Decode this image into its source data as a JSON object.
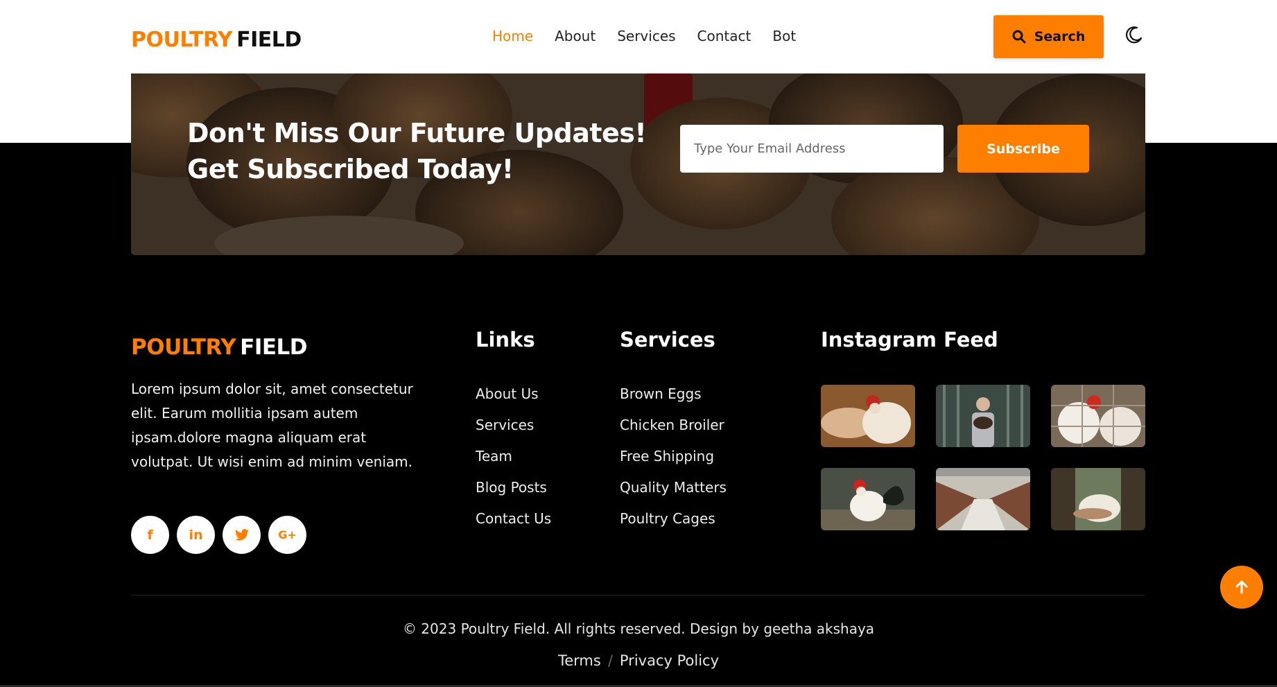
{
  "header": {
    "logo_primary": "POULTRY",
    "logo_secondary": "FIELD",
    "nav": [
      {
        "label": "Home",
        "active": true
      },
      {
        "label": "About"
      },
      {
        "label": "Services"
      },
      {
        "label": "Contact"
      },
      {
        "label": "Bot"
      }
    ],
    "search_label": "Search",
    "search_icon": "search-icon",
    "theme_icon": "moon-icon"
  },
  "banner": {
    "headline": "Don't Miss Our Future Updates!\nGet Subscribed Today!",
    "email_placeholder": "Type Your Email Address",
    "subscribe_label": "Subscribe"
  },
  "footer": {
    "logo_primary": "POULTRY",
    "logo_secondary": "FIELD",
    "about_text": "Lorem ipsum dolor sit, amet consectetur elit. Earum mollitia ipsam autem ipsam.dolore magna aliquam erat volutpat. Ut wisi enim ad minim veniam.",
    "socials": [
      {
        "icon": "facebook-icon",
        "glyph": "f"
      },
      {
        "icon": "linkedin-icon",
        "glyph": "in"
      },
      {
        "icon": "twitter-icon",
        "glyph": "t"
      },
      {
        "icon": "google-plus-icon",
        "glyph": "G+"
      }
    ],
    "links": {
      "title": "Links",
      "items": [
        "About Us",
        "Services",
        "Team",
        "Blog Posts",
        "Contact Us"
      ]
    },
    "services": {
      "title": "Services",
      "items": [
        "Brown Eggs",
        "Chicken Broiler",
        "Free Shipping",
        "Quality Matters",
        "Poultry Cages"
      ]
    },
    "instagram": {
      "title": "Instagram Feed",
      "images": [
        "hand-feeding-hen",
        "farmer-holding-chicken",
        "hens-in-cage",
        "rooster",
        "poultry-house-rows",
        "man-holding-hen"
      ]
    },
    "copyright": "© 2023 Poultry Field. All rights reserved. Design by geetha akshaya",
    "terms": "Terms",
    "separator": "/",
    "privacy": "Privacy Policy"
  },
  "colors": {
    "accent": "#fe7f00",
    "background": "#000000",
    "header_bg": "#ffffff"
  },
  "back_to_top_icon": "arrow-up-icon"
}
